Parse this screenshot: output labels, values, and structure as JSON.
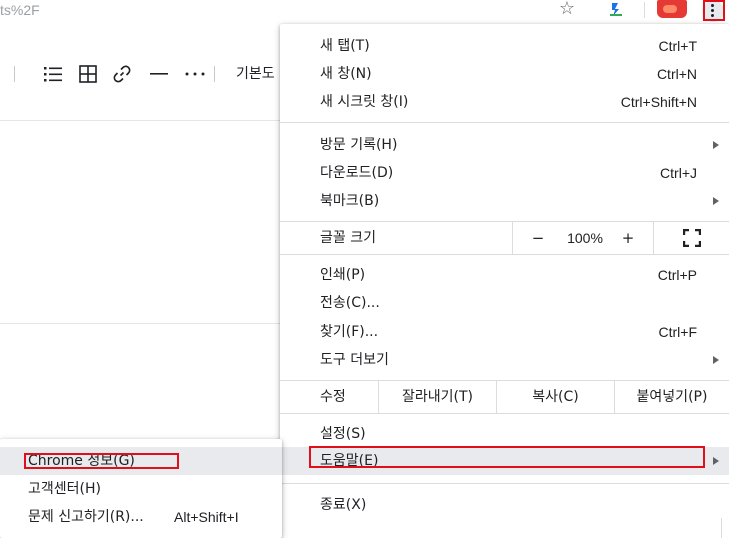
{
  "browser": {
    "url_fragment": "ts%2F",
    "bookmark_icon": "star-icon",
    "extension_icon": "extension-icon",
    "profile_icon": "avatar",
    "menu_icon": "kebab-menu-icon"
  },
  "editor_toolbar": {
    "tools": [
      "list-icon",
      "table-icon",
      "link-icon",
      "horizontal-rule-icon",
      "more-icon"
    ],
    "text_style_label": "기본도"
  },
  "menu": {
    "new_tab": {
      "label": "새 탭(T)",
      "shortcut": "Ctrl+T"
    },
    "new_window": {
      "label": "새 창(N)",
      "shortcut": "Ctrl+N"
    },
    "new_incognito": {
      "label": "새 시크릿 창(I)",
      "shortcut": "Ctrl+Shift+N"
    },
    "history": {
      "label": "방문 기록(H)"
    },
    "downloads": {
      "label": "다운로드(D)",
      "shortcut": "Ctrl+J"
    },
    "bookmarks": {
      "label": "북마크(B)"
    },
    "zoom": {
      "label": "글꼴 크기",
      "minus": "−",
      "value": "100%",
      "plus": "+",
      "fullscreen_icon": "fullscreen-icon"
    },
    "print": {
      "label": "인쇄(P)",
      "shortcut": "Ctrl+P"
    },
    "cast": {
      "label": "전송(C)..."
    },
    "find": {
      "label": "찾기(F)...",
      "shortcut": "Ctrl+F"
    },
    "more_tools": {
      "label": "도구 더보기"
    },
    "edit": {
      "label": "수정",
      "cut": "잘라내기(T)",
      "copy": "복사(C)",
      "paste": "붙여넣기(P)"
    },
    "settings": {
      "label": "설정(S)"
    },
    "help": {
      "label": "도움말(E)"
    },
    "exit": {
      "label": "종료(X)"
    }
  },
  "help_submenu": {
    "about": {
      "label": "Chrome 정보(G)"
    },
    "help_center": {
      "label": "고객센터(H)"
    },
    "report_issue": {
      "label": "문제 신고하기(R)...",
      "shortcut": "Alt+Shift+I"
    }
  },
  "colors": {
    "highlight_box": "#e0101a",
    "hover_bg": "#e8eaed",
    "divider": "#dadce0"
  }
}
